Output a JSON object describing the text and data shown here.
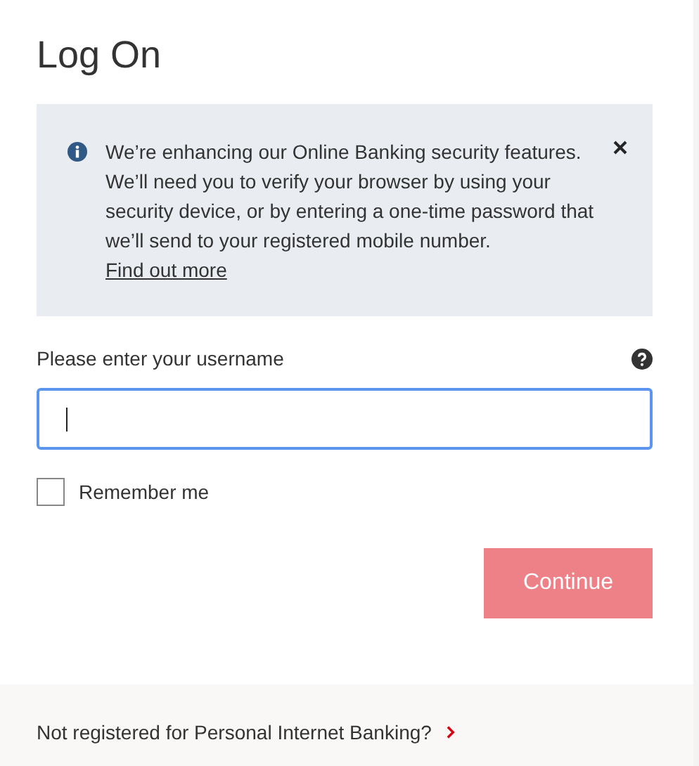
{
  "page": {
    "title": "Log On"
  },
  "notice": {
    "message": "We’re enhancing our Online Banking security features. We’ll need you to verify your browser by using your security device, or by entering a one-time password that we’ll send to your registered mobile number.",
    "link": "Find out more"
  },
  "username": {
    "label": "Please enter your username",
    "focused": true
  },
  "remember": {
    "label": "Remember me",
    "checked": false
  },
  "continue_button": {
    "label": "Continue",
    "disabled": true
  },
  "footer": {
    "link": "Not registered for Personal Internet Banking?"
  }
}
